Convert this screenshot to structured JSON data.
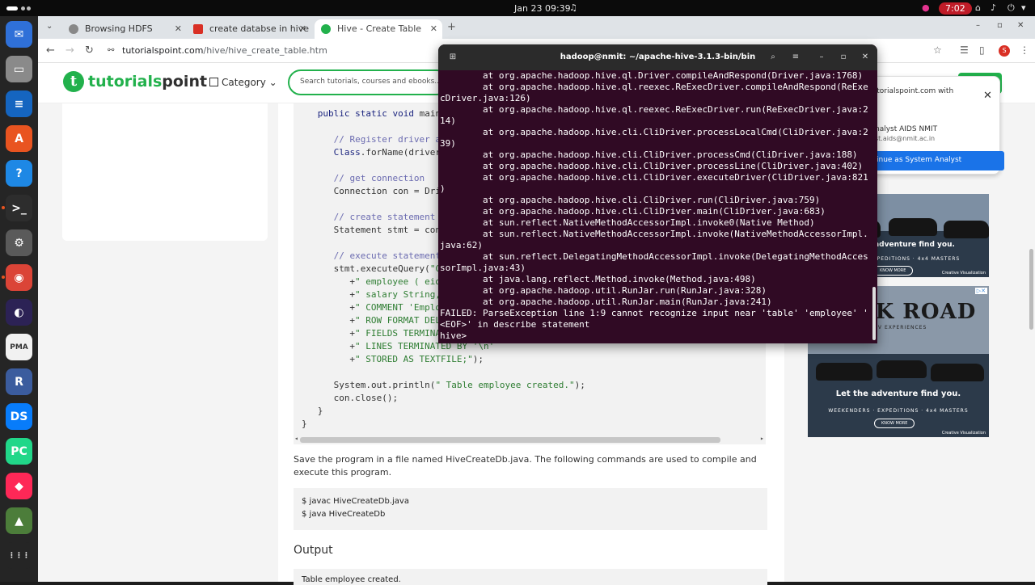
{
  "topbar": {
    "clock": "Jan 23  09:39",
    "recording": "7:02"
  },
  "dock": {
    "apps": [
      {
        "name": "thunderbird-icon",
        "glyph": "✉",
        "color": "#2f70d8"
      },
      {
        "name": "files-icon",
        "glyph": "▭",
        "color": "#8a8a8a"
      },
      {
        "name": "writer-icon",
        "glyph": "≡",
        "color": "#1565c0"
      },
      {
        "name": "software-center-icon",
        "glyph": "A",
        "color": "#e95420"
      },
      {
        "name": "help-icon",
        "glyph": "?",
        "color": "#1e88e5"
      },
      {
        "name": "terminal-icon",
        "glyph": ">_",
        "color": "#2d2d2d"
      },
      {
        "name": "settings-icon",
        "glyph": "⚙",
        "color": "#5a5a5a"
      },
      {
        "name": "chrome-icon",
        "glyph": "◉",
        "color": "#db4437"
      },
      {
        "name": "eclipse-icon",
        "glyph": "◐",
        "color": "#2c2255"
      },
      {
        "name": "phpmyadmin-icon",
        "glyph": "PMA",
        "color": "#f1f1f1"
      },
      {
        "name": "r-icon",
        "glyph": "R",
        "color": "#3b5c9e"
      },
      {
        "name": "dataspell-icon",
        "glyph": "DS",
        "color": "#087cfa"
      },
      {
        "name": "pycharm-icon",
        "glyph": "PC",
        "color": "#21d789"
      },
      {
        "name": "jetbrains-icon",
        "glyph": "◆",
        "color": "#fe2857"
      },
      {
        "name": "trash-icon",
        "glyph": "▲",
        "color": "#4c7d3a"
      },
      {
        "name": "app-grid-icon",
        "glyph": "⋮⋮⋮",
        "color": "#252525"
      }
    ]
  },
  "browser": {
    "tabs": [
      {
        "label": "Browsing HDFS",
        "icon_color": "#888"
      },
      {
        "label": "create databse in hive - ",
        "icon_color": "#d93025"
      },
      {
        "label": "Hive - Create Table",
        "icon_color": "#22b14c"
      }
    ],
    "url_host": "tutorialspoint.com",
    "url_path": "/hive/hive_create_table.htm",
    "profile_initial": "S"
  },
  "site": {
    "logo_prefix": "tutorials",
    "logo_suffix": "point",
    "logo_letter": "t",
    "category_label": "Category",
    "search_placeholder": "Search tutorials, courses and ebooks..."
  },
  "code_lines": [
    {
      "indent": 3,
      "parts": [
        {
          "c": "kw",
          "t": "public static void "
        },
        {
          "c": "",
          "t": "main"
        }
      ]
    },
    {
      "indent": 6,
      "parts": [
        {
          "c": "cm",
          "t": "// Register driver a"
        }
      ]
    },
    {
      "indent": 6,
      "parts": [
        {
          "c": "kw",
          "t": "Class"
        },
        {
          "c": "",
          "t": ".forName(driver"
        }
      ]
    },
    {
      "indent": 6,
      "parts": [
        {
          "c": "cm",
          "t": "// get connection"
        }
      ]
    },
    {
      "indent": 6,
      "parts": [
        {
          "c": "",
          "t": "Connection con = Dri"
        }
      ]
    },
    {
      "indent": 6,
      "parts": [
        {
          "c": "cm",
          "t": "// create statement"
        }
      ]
    },
    {
      "indent": 6,
      "parts": [
        {
          "c": "",
          "t": "Statement stmt = con"
        }
      ]
    },
    {
      "indent": 6,
      "parts": [
        {
          "c": "cm",
          "t": "// execute statement"
        }
      ]
    },
    {
      "indent": 6,
      "parts": [
        {
          "c": "",
          "t": "stmt.executeQuery("
        },
        {
          "c": "st",
          "t": "\"C"
        }
      ]
    },
    {
      "indent": 9,
      "parts": [
        {
          "c": "",
          "t": "+"
        },
        {
          "c": "st",
          "t": "\" employee ( eid"
        }
      ]
    },
    {
      "indent": 9,
      "parts": [
        {
          "c": "",
          "t": "+"
        },
        {
          "c": "st",
          "t": "\" salary String,"
        }
      ]
    },
    {
      "indent": 9,
      "parts": [
        {
          "c": "",
          "t": "+"
        },
        {
          "c": "st",
          "t": "\" COMMENT 'Emplo"
        }
      ]
    },
    {
      "indent": 9,
      "parts": [
        {
          "c": "",
          "t": "+"
        },
        {
          "c": "st",
          "t": "\" ROW FORMAT DEL"
        }
      ]
    },
    {
      "indent": 9,
      "parts": [
        {
          "c": "",
          "t": "+"
        },
        {
          "c": "st",
          "t": "\" FIELDS TERMINA"
        }
      ]
    },
    {
      "indent": 9,
      "parts": [
        {
          "c": "",
          "t": "+"
        },
        {
          "c": "st",
          "t": "\" LINES TERMINATED BY '\\n'"
        }
      ]
    },
    {
      "indent": 9,
      "parts": [
        {
          "c": "",
          "t": "+"
        },
        {
          "c": "st",
          "t": "\" STORED AS TEXTFILE;\""
        },
        {
          "c": "",
          "t": ");"
        }
      ]
    },
    {
      "indent": 6,
      "parts": [
        {
          "c": "",
          "t": "System.out.println("
        },
        {
          "c": "st",
          "t": "\" Table employee created.\""
        },
        {
          "c": "",
          "t": ");"
        }
      ]
    },
    {
      "indent": 6,
      "parts": [
        {
          "c": "",
          "t": "con.close();"
        }
      ]
    },
    {
      "indent": 3,
      "parts": [
        {
          "c": "",
          "t": "}"
        }
      ]
    },
    {
      "indent": 0,
      "parts": [
        {
          "c": "",
          "t": "}"
        }
      ]
    }
  ],
  "article": {
    "para": "Save the program in a file named HiveCreateDb.java. The following commands are used to compile and execute this program.",
    "cmd1": "$ javac HiveCreateDb.java",
    "cmd2": "$ java HiveCreateDb",
    "output_heading": "Output",
    "output_text": "Table employee created."
  },
  "signin": {
    "title": "tutorialspoint.com with",
    "name": "nalyst AIDS NMIT",
    "email": "st.aids@nmit.ac.in",
    "continue": "inue as System Analyst"
  },
  "ads": {
    "tagline": "Let the adventure find you.",
    "tagline_top": "adventure find you.",
    "sub": "WEEKENDERS · EXPEDITIONS · 4x4 MASTERS",
    "sub_top": "EXPEDITIONS · 4x4 MASTERS",
    "know_more": "KNOW MORE",
    "brand": "Creative Visualization",
    "rock_road": "ROCK ROAD",
    "rock_road_sub": "SUV EXPERIENCES"
  },
  "terminal": {
    "title": "hadoop@nmit: ~/apache-hive-3.1.3-bin/bin",
    "lines": [
      "        at org.apache.hadoop.hive.ql.Driver.compileAndRespond(Driver.java:1768)",
      "        at org.apache.hadoop.hive.ql.reexec.ReExecDriver.compileAndRespond(ReExe",
      "cDriver.java:126)",
      "        at org.apache.hadoop.hive.ql.reexec.ReExecDriver.run(ReExecDriver.java:2",
      "14)",
      "        at org.apache.hadoop.hive.cli.CliDriver.processLocalCmd(CliDriver.java:2",
      "39)",
      "        at org.apache.hadoop.hive.cli.CliDriver.processCmd(CliDriver.java:188)",
      "        at org.apache.hadoop.hive.cli.CliDriver.processLine(CliDriver.java:402)",
      "        at org.apache.hadoop.hive.cli.CliDriver.executeDriver(CliDriver.java:821",
      ")",
      "        at org.apache.hadoop.hive.cli.CliDriver.run(CliDriver.java:759)",
      "        at org.apache.hadoop.hive.cli.CliDriver.main(CliDriver.java:683)",
      "        at sun.reflect.NativeMethodAccessorImpl.invoke0(Native Method)",
      "        at sun.reflect.NativeMethodAccessorImpl.invoke(NativeMethodAccessorImpl.",
      "java:62)",
      "        at sun.reflect.DelegatingMethodAccessorImpl.invoke(DelegatingMethodAcces",
      "sorImpl.java:43)",
      "        at java.lang.reflect.Method.invoke(Method.java:498)",
      "        at org.apache.hadoop.util.RunJar.run(RunJar.java:328)",
      "        at org.apache.hadoop.util.RunJar.main(RunJar.java:241)",
      "FAILED: ParseException line 1:9 cannot recognize input near 'table' 'employee' '",
      "<EOF>' in describe statement",
      "hive> "
    ]
  }
}
